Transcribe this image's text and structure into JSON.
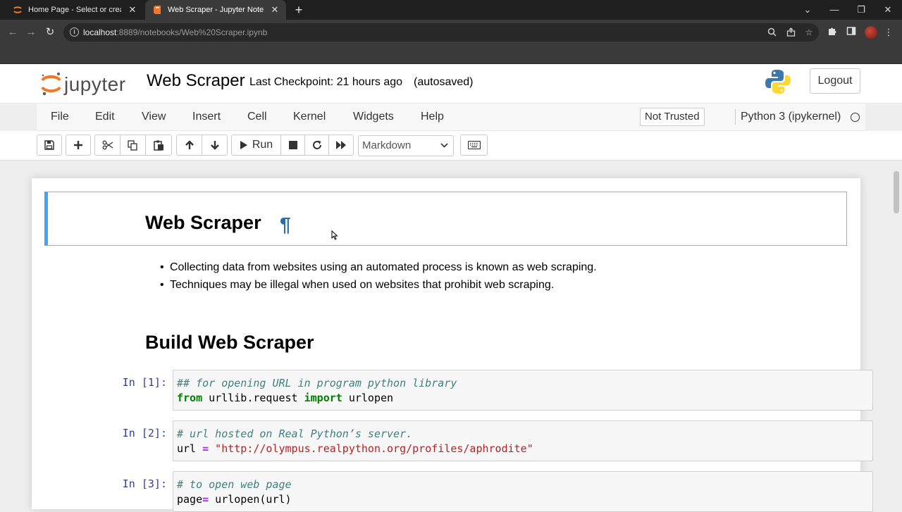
{
  "browser": {
    "tabs": [
      {
        "title": "Home Page - Select or create a n",
        "active": false
      },
      {
        "title": "Web Scraper - Jupyter Notebook",
        "active": true
      }
    ],
    "new_tab": "+",
    "url_host": "localhost",
    "url_rest": ":8889/notebooks/Web%20Scraper.ipynb"
  },
  "jupyter": {
    "logo_word": "jupyter",
    "notebook_title": "Web Scraper",
    "checkpoint": "Last Checkpoint: 21 hours ago",
    "autosave": "(autosaved)",
    "logout": "Logout",
    "menu": [
      "File",
      "Edit",
      "View",
      "Insert",
      "Cell",
      "Kernel",
      "Widgets",
      "Help"
    ],
    "trust": "Not Trusted",
    "kernel": "Python 3 (ipykernel)",
    "run_label": "Run",
    "cell_type": "Markdown"
  },
  "notebook": {
    "heading1": "Web Scraper",
    "pilcrow": "¶",
    "bullets": [
      "Collecting data from websites using an automated process is known as web scraping.",
      "Techniques may be illegal when used on websites that prohibit web scraping."
    ],
    "heading2": "Build Web Scraper",
    "cells": [
      {
        "prompt": "In [1]:",
        "line1_comment": "## for opening URL in program python library",
        "line2_kw1": "from",
        "line2_mod": " urllib.request ",
        "line2_kw2": "import",
        "line2_name": " urlopen"
      },
      {
        "prompt": "In [2]:",
        "line1_comment": "# url hosted on Real Python’s server.",
        "line2_var": "url ",
        "line2_op": "=",
        "line2_str": " \"http://olympus.realpython.org/profiles/aphrodite\""
      },
      {
        "prompt": "In [3]:",
        "line1_comment": "# to open web page",
        "line2_var": "page",
        "line2_op": "=",
        "line2_rest": " urlopen(url)"
      }
    ]
  },
  "colors": {
    "selected_cell_bar": "#42a5f5",
    "prompt": "#303f9f",
    "comment": "#408080",
    "keyword": "#008000",
    "string": "#ba2121"
  }
}
